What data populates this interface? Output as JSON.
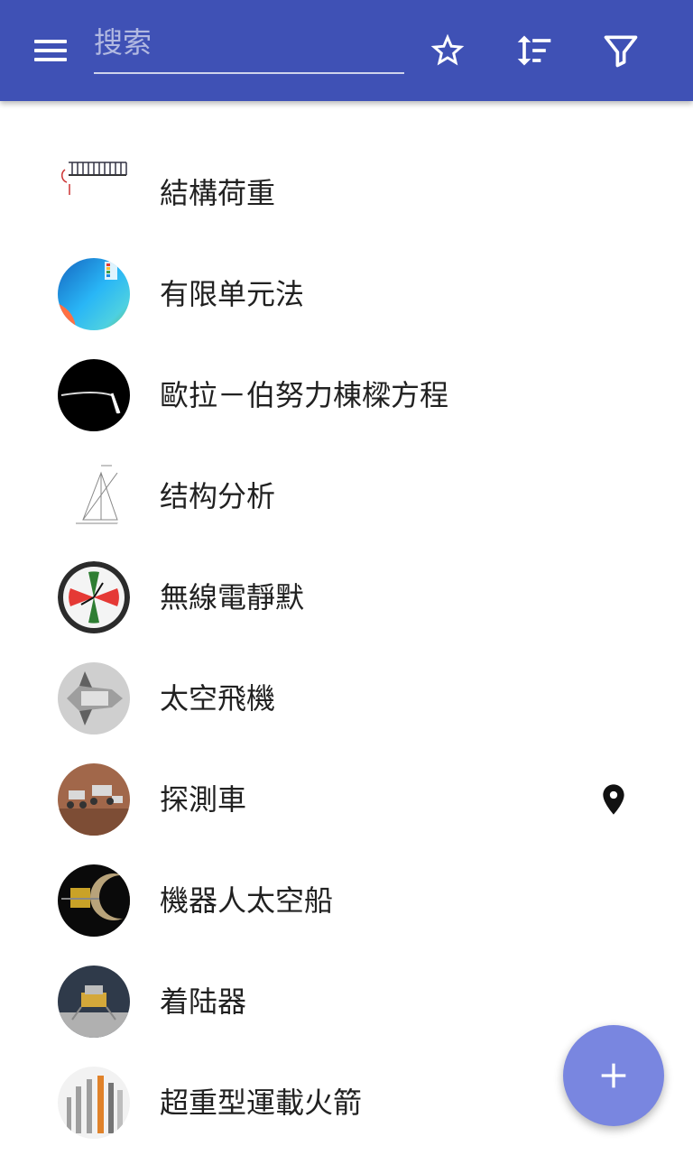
{
  "colors": {
    "primary": "#3f51b5",
    "accent": "#7986e0"
  },
  "toolbar": {
    "menu_icon": "hamburger-menu-icon",
    "search_placeholder": "搜索",
    "actions": [
      "star-icon",
      "sort-icon",
      "filter-icon"
    ]
  },
  "list": {
    "items": [
      {
        "label": "結構荷重",
        "thumbnail": "structural-load-diagram"
      },
      {
        "label": "有限单元法",
        "thumbnail": "finite-element-simulation"
      },
      {
        "label": "歐拉－伯努力棟樑方程",
        "thumbnail": "deflected-beam"
      },
      {
        "label": "结构分析",
        "thumbnail": "truss-drawing"
      },
      {
        "label": "無線電靜默",
        "thumbnail": "radio-room-clock"
      },
      {
        "label": "太空飛機",
        "thumbnail": "space-shuttle"
      },
      {
        "label": "探測車",
        "thumbnail": "rovers",
        "trailing_icon": "location-pin-icon"
      },
      {
        "label": "機器人太空船",
        "thumbnail": "robotic-spacecraft"
      },
      {
        "label": "着陆器",
        "thumbnail": "lunar-lander"
      },
      {
        "label": "超重型運載火箭",
        "thumbnail": "heavy-lift-rockets"
      }
    ]
  },
  "fab": {
    "icon": "plus-icon"
  }
}
